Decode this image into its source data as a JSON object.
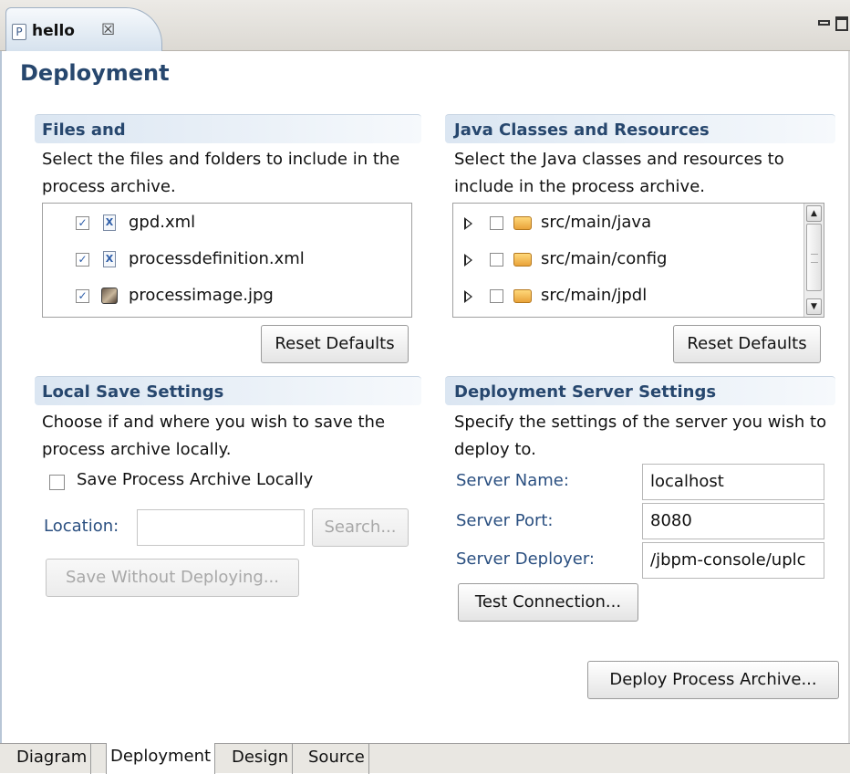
{
  "editor_tab": {
    "icon_letter": "P",
    "title": "hello",
    "close_glyph": "☒"
  },
  "page_title": "Deployment",
  "files_section": {
    "title": "Files and",
    "description": "Select the files and folders to include in the process archive.",
    "items": [
      {
        "label": "gpd.xml",
        "checked": true,
        "icon": "xml-file-icon"
      },
      {
        "label": "processdefinition.xml",
        "checked": true,
        "icon": "xml-file-icon"
      },
      {
        "label": "processimage.jpg",
        "checked": true,
        "icon": "image-file-icon"
      }
    ],
    "reset_label": "Reset Defaults"
  },
  "java_section": {
    "title": "Java Classes and Resources",
    "description": "Select the Java classes and resources to include in the process archive.",
    "items": [
      {
        "label": "src/main/java",
        "checked": false,
        "icon": "source-folder-icon"
      },
      {
        "label": "src/main/config",
        "checked": false,
        "icon": "source-folder-icon"
      },
      {
        "label": "src/main/jpdl",
        "checked": false,
        "icon": "source-folder-icon"
      }
    ],
    "reset_label": "Reset Defaults"
  },
  "local_save": {
    "title": "Local Save Settings",
    "description": "Choose if and where you wish to save the process archive locally.",
    "checkbox_label": "Save Process Archive Locally",
    "checkbox_checked": false,
    "location_label": "Location:",
    "location_value": "",
    "search_label": "Search...",
    "save_button_label": "Save Without Deploying..."
  },
  "server_settings": {
    "title": "Deployment Server Settings",
    "description": "Specify the settings of the server you wish to deploy to.",
    "server_name_label": "Server Name:",
    "server_name_value": "localhost",
    "server_port_label": "Server Port:",
    "server_port_value": "8080",
    "server_deployer_label": "Server Deployer:",
    "server_deployer_value": "/jbpm-console/uplc",
    "test_connection_label": "Test Connection..."
  },
  "deploy_button_label": "Deploy Process Archive...",
  "bottom_tabs": [
    {
      "label": "Diagram",
      "active": false
    },
    {
      "label": "Deployment",
      "active": true
    },
    {
      "label": "Design",
      "active": false
    },
    {
      "label": "Source",
      "active": false
    }
  ],
  "colors": {
    "section_title": "#27476e",
    "field_label": "#2a4f80",
    "checkmark": "#2d5da8"
  }
}
